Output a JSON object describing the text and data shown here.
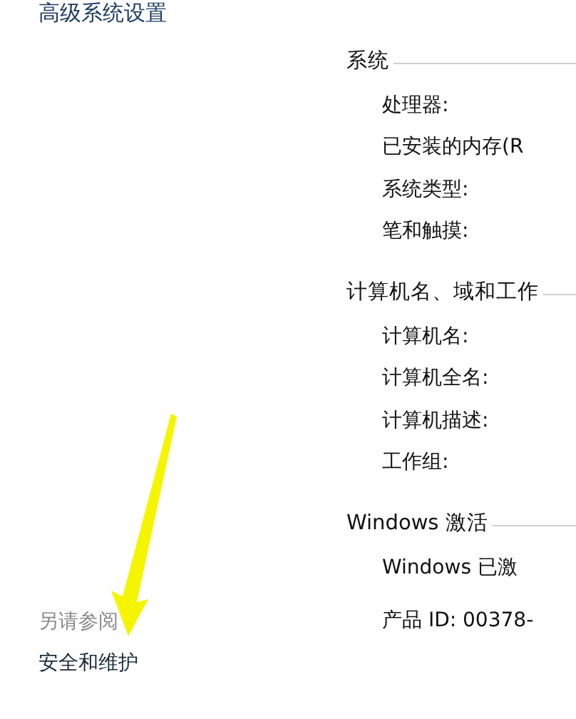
{
  "sidebar": {
    "links": [
      {
        "label": "高级系统设置"
      }
    ],
    "see_also": {
      "heading": "另请参阅",
      "links": [
        {
          "label": "安全和维护"
        }
      ]
    }
  },
  "sections": [
    {
      "title": "系统",
      "rows": [
        {
          "label": "处理器:"
        },
        {
          "label": "已安装的内存(R"
        },
        {
          "label": "系统类型:"
        },
        {
          "label": "笔和触摸:"
        }
      ]
    },
    {
      "title": "计算机名、域和工作",
      "rows": [
        {
          "label": "计算机名:"
        },
        {
          "label": "计算机全名:"
        },
        {
          "label": "计算机描述:"
        },
        {
          "label": "工作组:"
        }
      ]
    },
    {
      "title": "Windows 激活",
      "rows": [
        {
          "label": "Windows 已激"
        },
        {
          "label": "产品 ID: 00378-"
        }
      ]
    }
  ]
}
